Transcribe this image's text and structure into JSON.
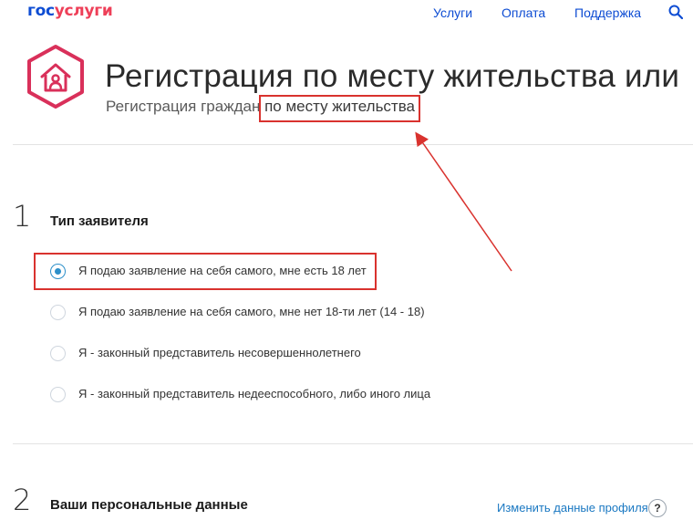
{
  "header": {
    "logo_part1": "гос",
    "logo_part2": "услуги",
    "nav": [
      "Услуги",
      "Оплата",
      "Поддержка"
    ]
  },
  "service": {
    "title": "Регистрация по месту жительства или",
    "subtitle_prefix": "Регистрация граждан ",
    "subtitle_highlight": "по месту жительства"
  },
  "steps": [
    {
      "number": "1",
      "title": "Тип заявителя",
      "options": [
        {
          "label": "Я подаю заявление на себя самого, мне есть 18 лет",
          "checked": true
        },
        {
          "label": "Я подаю заявление на себя самого, мне нет 18-ти лет (14 - 18)",
          "checked": false
        },
        {
          "label": "Я - законный представитель несовершеннолетнего",
          "checked": false
        },
        {
          "label": "Я - законный представитель недееспособного, либо иного лица",
          "checked": false
        }
      ]
    },
    {
      "number": "2",
      "title": "Ваши персональные данные",
      "link": "Изменить данные профиля",
      "help": "?"
    }
  ],
  "colors": {
    "logo_blue": "#0d4cd3",
    "logo_red": "#ee3f58",
    "annotation_red": "#d9322e",
    "radio_accent": "#2c8fc9",
    "service_icon": "#d9305a"
  }
}
